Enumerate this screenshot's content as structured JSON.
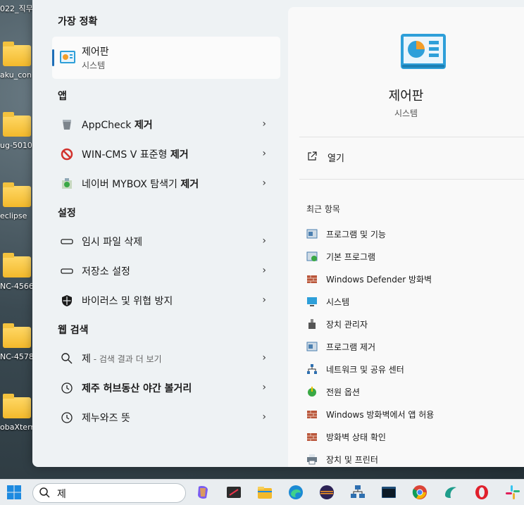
{
  "desktop": {
    "icons": [
      {
        "label": "022_직무"
      },
      {
        "label": "aku_con"
      },
      {
        "label": "ug-5010"
      },
      {
        "label": "eclipse"
      },
      {
        "label": "NC-4566"
      },
      {
        "label": "NC-4578"
      },
      {
        "label": "obaXterm"
      }
    ]
  },
  "left": {
    "best_match_title": "가장 정확",
    "best_match": {
      "name": "제어판",
      "type": "시스템"
    },
    "apps_title": "앱",
    "apps": [
      {
        "label": "AppCheck ",
        "bold": "제거",
        "icon": "appcheck-icon"
      },
      {
        "label": "WIN-CMS V 표준형 ",
        "bold": "제거",
        "icon": "no-entry-icon"
      },
      {
        "label": "네이버 MYBOX 탐색기 ",
        "bold": "제거",
        "icon": "installer-icon"
      }
    ],
    "settings_title": "설정",
    "settings": [
      {
        "label": "임시 파일 삭제",
        "icon": "storage-icon"
      },
      {
        "label": "저장소 설정",
        "icon": "storage-icon"
      },
      {
        "label": "바이러스 및 위협 방지",
        "icon": "shield-icon"
      }
    ],
    "web_title": "웹 검색",
    "web": [
      {
        "label": "제",
        "dim": " - 검색 결과 더 보기",
        "icon": "search-icon"
      },
      {
        "label": "",
        "bold": "제주 허브동산 야간 볼거리",
        "icon": "history-icon"
      },
      {
        "label": "제누와즈 뜻",
        "icon": "history-icon"
      }
    ]
  },
  "right": {
    "title": "제어판",
    "subtitle": "시스템",
    "open_label": "열기",
    "recent_title": "최근 항목",
    "recent": [
      {
        "label": "프로그램 및 기능"
      },
      {
        "label": "기본 프로그램"
      },
      {
        "label": "Windows Defender 방화벽"
      },
      {
        "label": "시스템"
      },
      {
        "label": "장치 관리자"
      },
      {
        "label": "프로그램 제거"
      },
      {
        "label": "네트워크 및 공유 센터"
      },
      {
        "label": "전원 옵션"
      },
      {
        "label": "Windows 방화벽에서 앱 허용"
      },
      {
        "label": "방화벽 상태 확인"
      },
      {
        "label": "장치 및 프린터"
      }
    ]
  },
  "taskbar": {
    "search_value": "제"
  },
  "colors": {
    "accent": "#1f6fb8",
    "panel": "#eef2f4",
    "right_panel": "#f9f9f9"
  }
}
